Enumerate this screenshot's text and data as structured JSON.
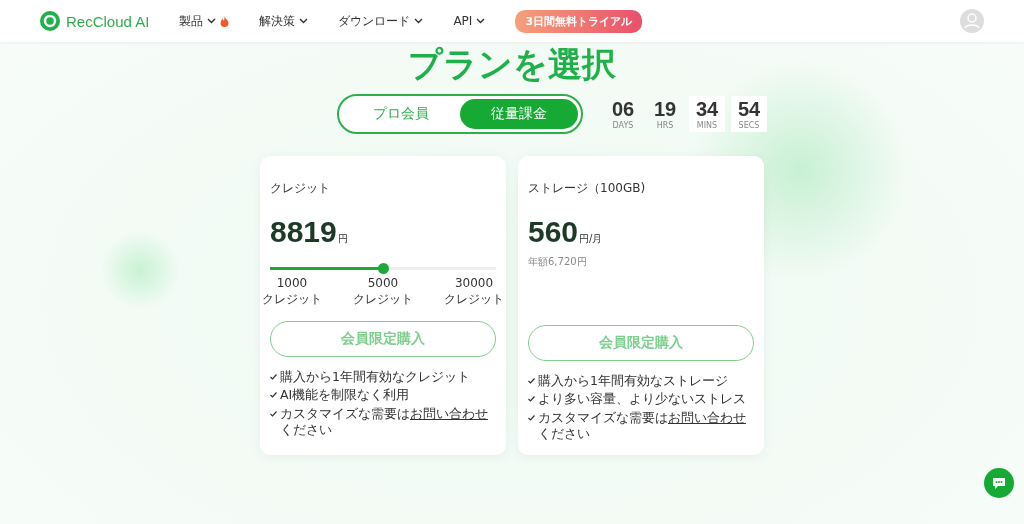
{
  "header": {
    "brand": "RecCloud AI",
    "nav": [
      {
        "label": "製品",
        "hot": true
      },
      {
        "label": "解決策",
        "hot": false
      },
      {
        "label": "ダウンロード",
        "hot": false
      },
      {
        "label": "API",
        "hot": false
      }
    ],
    "promo": "3日間無料トライアル"
  },
  "title": "プランを選択",
  "plan_tabs": [
    {
      "label": "プロ会員",
      "selected": false
    },
    {
      "label": "従量課金",
      "selected": true
    }
  ],
  "countdown": [
    {
      "value": "06",
      "unit": "DAYS",
      "boxed": false
    },
    {
      "value": "19",
      "unit": "HRS",
      "boxed": false
    },
    {
      "value": "34",
      "unit": "MINS",
      "boxed": true
    },
    {
      "value": "54",
      "unit": "SECS",
      "boxed": true
    }
  ],
  "cards": [
    {
      "kind": "slider",
      "name": "クレジット",
      "price": "8819",
      "unit": "円",
      "slider": {
        "level": 0.5,
        "ticks": [
          {
            "value": "1000",
            "label": "クレジット"
          },
          {
            "value": "5000",
            "label": "クレジット"
          },
          {
            "value": "30000",
            "label": "クレジット"
          }
        ]
      },
      "button": "会員限定購入",
      "features": [
        {
          "text": "購入から1年間有効なクレジット"
        },
        {
          "text": "AI機能を制限なく利用"
        },
        {
          "text": "カスタマイズな需要は",
          "link": "お問い合わせ",
          "after": "ください"
        }
      ]
    },
    {
      "kind": "plain",
      "name": "ストレージ（100GB)",
      "price": "560",
      "unit": "円/月",
      "note": "年額6,720円",
      "button": "会員限定購入",
      "features": [
        {
          "text": "購入から1年間有効なストレージ"
        },
        {
          "text": "より多い容量、より少ないストレス"
        },
        {
          "text": "カスタマイズな需要は",
          "link": "お問い合わせ",
          "after": "ください"
        }
      ]
    }
  ]
}
